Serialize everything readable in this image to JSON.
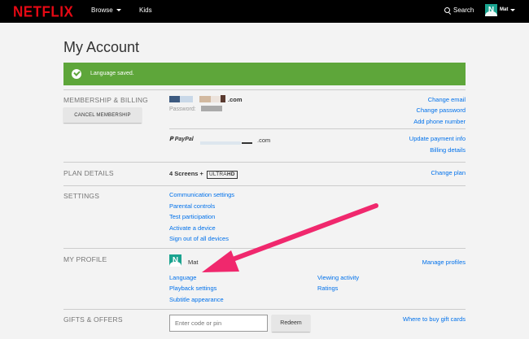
{
  "header": {
    "logo": "NETFLIX",
    "nav": {
      "browse": "Browse",
      "kids": "Kids"
    },
    "search_label": "Search",
    "profile": {
      "avatar_letter": "N",
      "name": "Mat"
    }
  },
  "page_title": "My Account",
  "banner": {
    "message": "Language saved."
  },
  "membership": {
    "label": "MEMBERSHIP & BILLING",
    "cancel_button": "CANCEL MEMBERSHIP",
    "email_suffix": ".com",
    "password_label": "Password:",
    "links": [
      "Change email",
      "Change password",
      "Add phone number"
    ],
    "payment": {
      "brand": "PayPal",
      "email_suffix": ".com",
      "links": [
        "Update payment info",
        "Billing details"
      ]
    }
  },
  "plan": {
    "label": "PLAN DETAILS",
    "screens": "4 Screens +",
    "badge_ultra": "ULTRA",
    "badge_hd": "HD",
    "link": "Change plan"
  },
  "settings": {
    "label": "SETTINGS",
    "links": [
      "Communication settings",
      "Parental controls",
      "Test participation",
      "Activate a device",
      "Sign out of all devices"
    ]
  },
  "my_profile": {
    "label": "MY PROFILE",
    "avatar_letter": "N",
    "name": "Mat",
    "manage_link": "Manage profiles",
    "left_links": [
      "Language",
      "Playback settings",
      "Subtitle appearance"
    ],
    "right_links": [
      "Viewing activity",
      "Ratings"
    ]
  },
  "gifts": {
    "label": "GIFTS & OFFERS",
    "input_placeholder": "Enter code or pin",
    "redeem_button": "Redeem",
    "link": "Where to buy gift cards"
  },
  "colors": {
    "brand_red": "#e50914",
    "success_green": "#5ea63a",
    "link_blue": "#0071eb",
    "arrow_pink": "#f0286d",
    "avatar_teal": "#1aa38f"
  }
}
